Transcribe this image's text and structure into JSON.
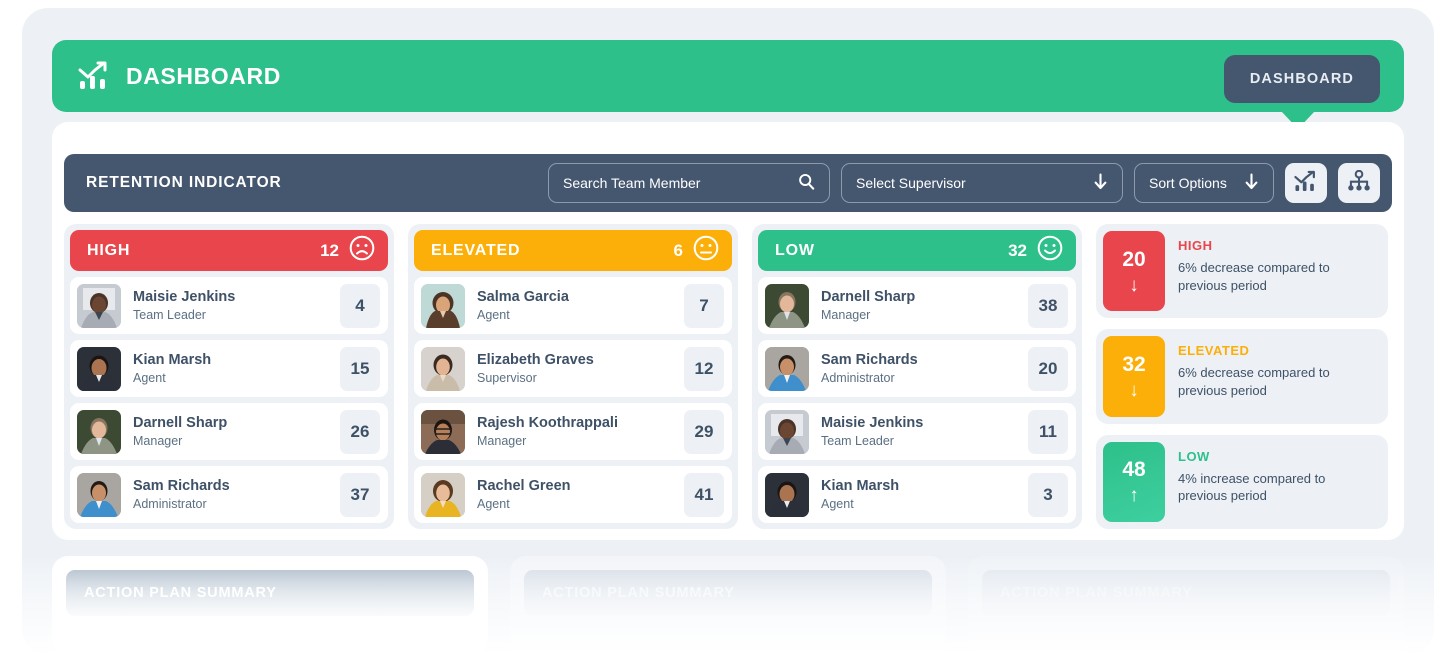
{
  "header": {
    "title": "DASHBOARD",
    "logo_icon": "chart-trend-icon",
    "tooltip_label": "DASHBOARD"
  },
  "toolbar": {
    "title": "RETENTION INDICATOR",
    "search_placeholder": "Search Team Member",
    "search_icon": "search-icon",
    "supervisor_label": "Select Supervisor",
    "supervisor_icon": "arrow-down-icon",
    "sort_label": "Sort Options",
    "sort_icon": "arrow-down-icon",
    "chart_view_icon": "chart-trend-icon",
    "org_view_icon": "org-chart-icon"
  },
  "columns": [
    {
      "label": "HIGH",
      "count": "12",
      "face_icon": "sad-face-icon",
      "color": "#E8464C",
      "people": [
        {
          "name": "Maisie Jenkins",
          "role": "Team Leader",
          "score": "4"
        },
        {
          "name": "Kian Marsh",
          "role": "Agent",
          "score": "15"
        },
        {
          "name": "Darnell Sharp",
          "role": "Manager",
          "score": "26"
        },
        {
          "name": "Sam Richards",
          "role": "Administrator",
          "score": "37"
        }
      ]
    },
    {
      "label": "ELEVATED",
      "count": "6",
      "face_icon": "neutral-face-icon",
      "color": "#FBAF08",
      "people": [
        {
          "name": "Salma Garcia",
          "role": "Agent",
          "score": "7"
        },
        {
          "name": "Elizabeth Graves",
          "role": "Supervisor",
          "score": "12"
        },
        {
          "name": "Rajesh Koothrappali",
          "role": "Manager",
          "score": "29"
        },
        {
          "name": "Rachel Green",
          "role": "Agent",
          "score": "41"
        }
      ]
    },
    {
      "label": "LOW",
      "count": "32",
      "face_icon": "happy-face-icon",
      "color": "#2EC08A",
      "people": [
        {
          "name": "Darnell Sharp",
          "role": "Manager",
          "score": "38"
        },
        {
          "name": "Sam Richards",
          "role": "Administrator",
          "score": "20"
        },
        {
          "name": "Maisie Jenkins",
          "role": "Team Leader",
          "score": "11"
        },
        {
          "name": "Kian Marsh",
          "role": "Agent",
          "score": "3"
        }
      ]
    }
  ],
  "summary": [
    {
      "value": "20",
      "trend_icon": "arrow-down-icon",
      "trend_glyph": "↓",
      "label": "HIGH",
      "text": "6% decrease compared to previous period",
      "color": "#E8464C"
    },
    {
      "value": "32",
      "trend_icon": "arrow-down-icon",
      "trend_glyph": "↓",
      "label": "ELEVATED",
      "text": "6% decrease compared to previous period",
      "color": "#FBAF08"
    },
    {
      "value": "48",
      "trend_icon": "arrow-up-icon",
      "trend_glyph": "↑",
      "label": "LOW",
      "text": "4% increase compared to previous period",
      "color": "#2EC08A"
    }
  ],
  "bottom_cards": [
    {
      "title": "ACTION PLAN SUMMARY"
    },
    {
      "title": "ACTION PLAN SUMMARY"
    },
    {
      "title": "ACTION PLAN SUMMARY"
    }
  ]
}
